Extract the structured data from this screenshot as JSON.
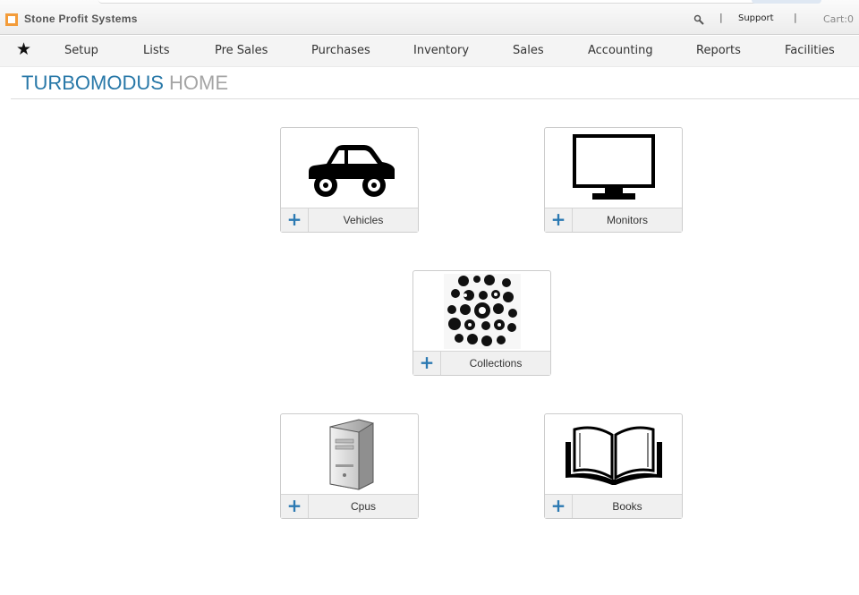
{
  "header": {
    "brand": "Stone Profit Systems",
    "support_label": "Support",
    "cart_label": "Cart:0",
    "separator": "|",
    "brand_color": "#f39c3a",
    "search_icon": "search-icon"
  },
  "nav": {
    "home_icon": "star-icon",
    "items": [
      "Setup",
      "Lists",
      "Pre Sales",
      "Purchases",
      "Inventory",
      "Sales",
      "Accounting",
      "Reports",
      "Facilities"
    ]
  },
  "page": {
    "title_primary": "TURBOMODUS",
    "title_secondary": "HOME",
    "title_color": "#2878a8"
  },
  "tiles": [
    {
      "label": "Vehicles",
      "add_symbol": "+",
      "icon": "car-icon"
    },
    {
      "label": "Monitors",
      "add_symbol": "+",
      "icon": "monitor-icon"
    },
    {
      "label": "Collections",
      "add_symbol": "+",
      "icon": "collections-icon"
    },
    {
      "label": "Cpus",
      "add_symbol": "+",
      "icon": "cpu-tower-icon"
    },
    {
      "label": "Books",
      "add_symbol": "+",
      "icon": "book-icon"
    }
  ]
}
